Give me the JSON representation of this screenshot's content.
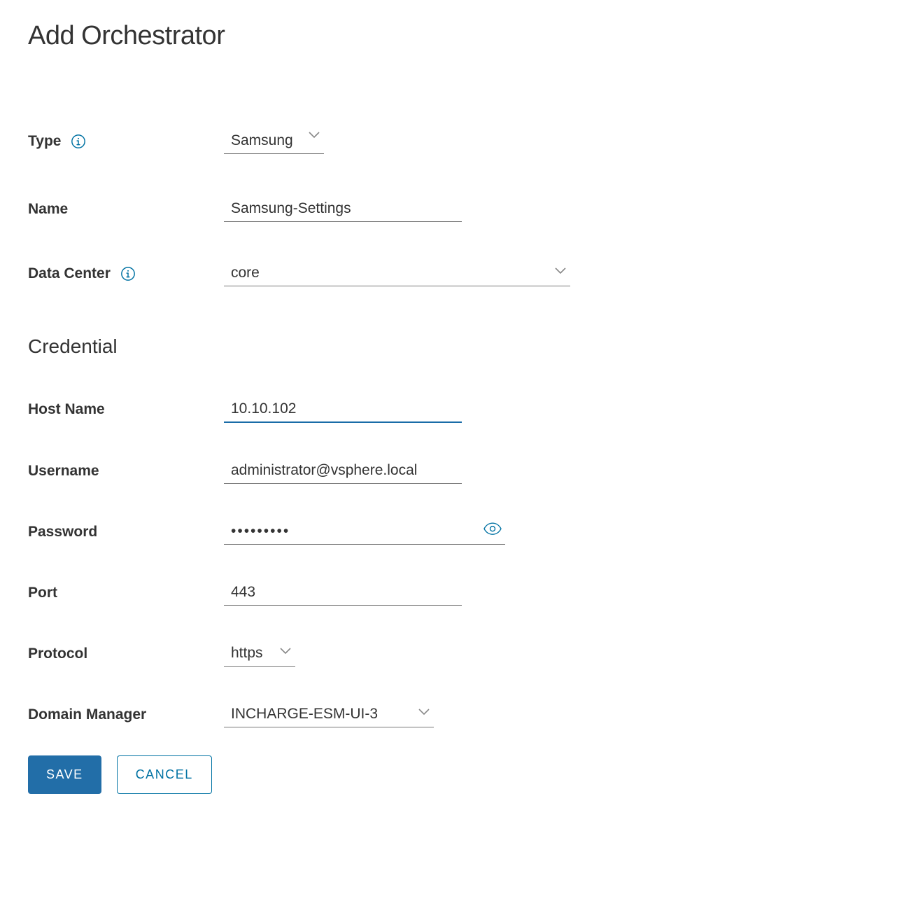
{
  "title": "Add Orchestrator",
  "labels": {
    "type": "Type",
    "name": "Name",
    "dataCenter": "Data Center",
    "credential": "Credential",
    "hostName": "Host Name",
    "username": "Username",
    "password": "Password",
    "port": "Port",
    "protocol": "Protocol",
    "domainManager": "Domain Manager"
  },
  "values": {
    "type": "Samsung",
    "name": "Samsung-Settings",
    "dataCenter": "core",
    "hostName": "10.10.102",
    "username": "administrator@vsphere.local",
    "password": "•••••••••",
    "port": "443",
    "protocol": "https",
    "domainManager": "INCHARGE-ESM-UI-3"
  },
  "buttons": {
    "save": "SAVE",
    "cancel": "CANCEL"
  },
  "colors": {
    "primary": "#226ea8",
    "link": "#0072a3",
    "focus": "#1a6ca8"
  }
}
